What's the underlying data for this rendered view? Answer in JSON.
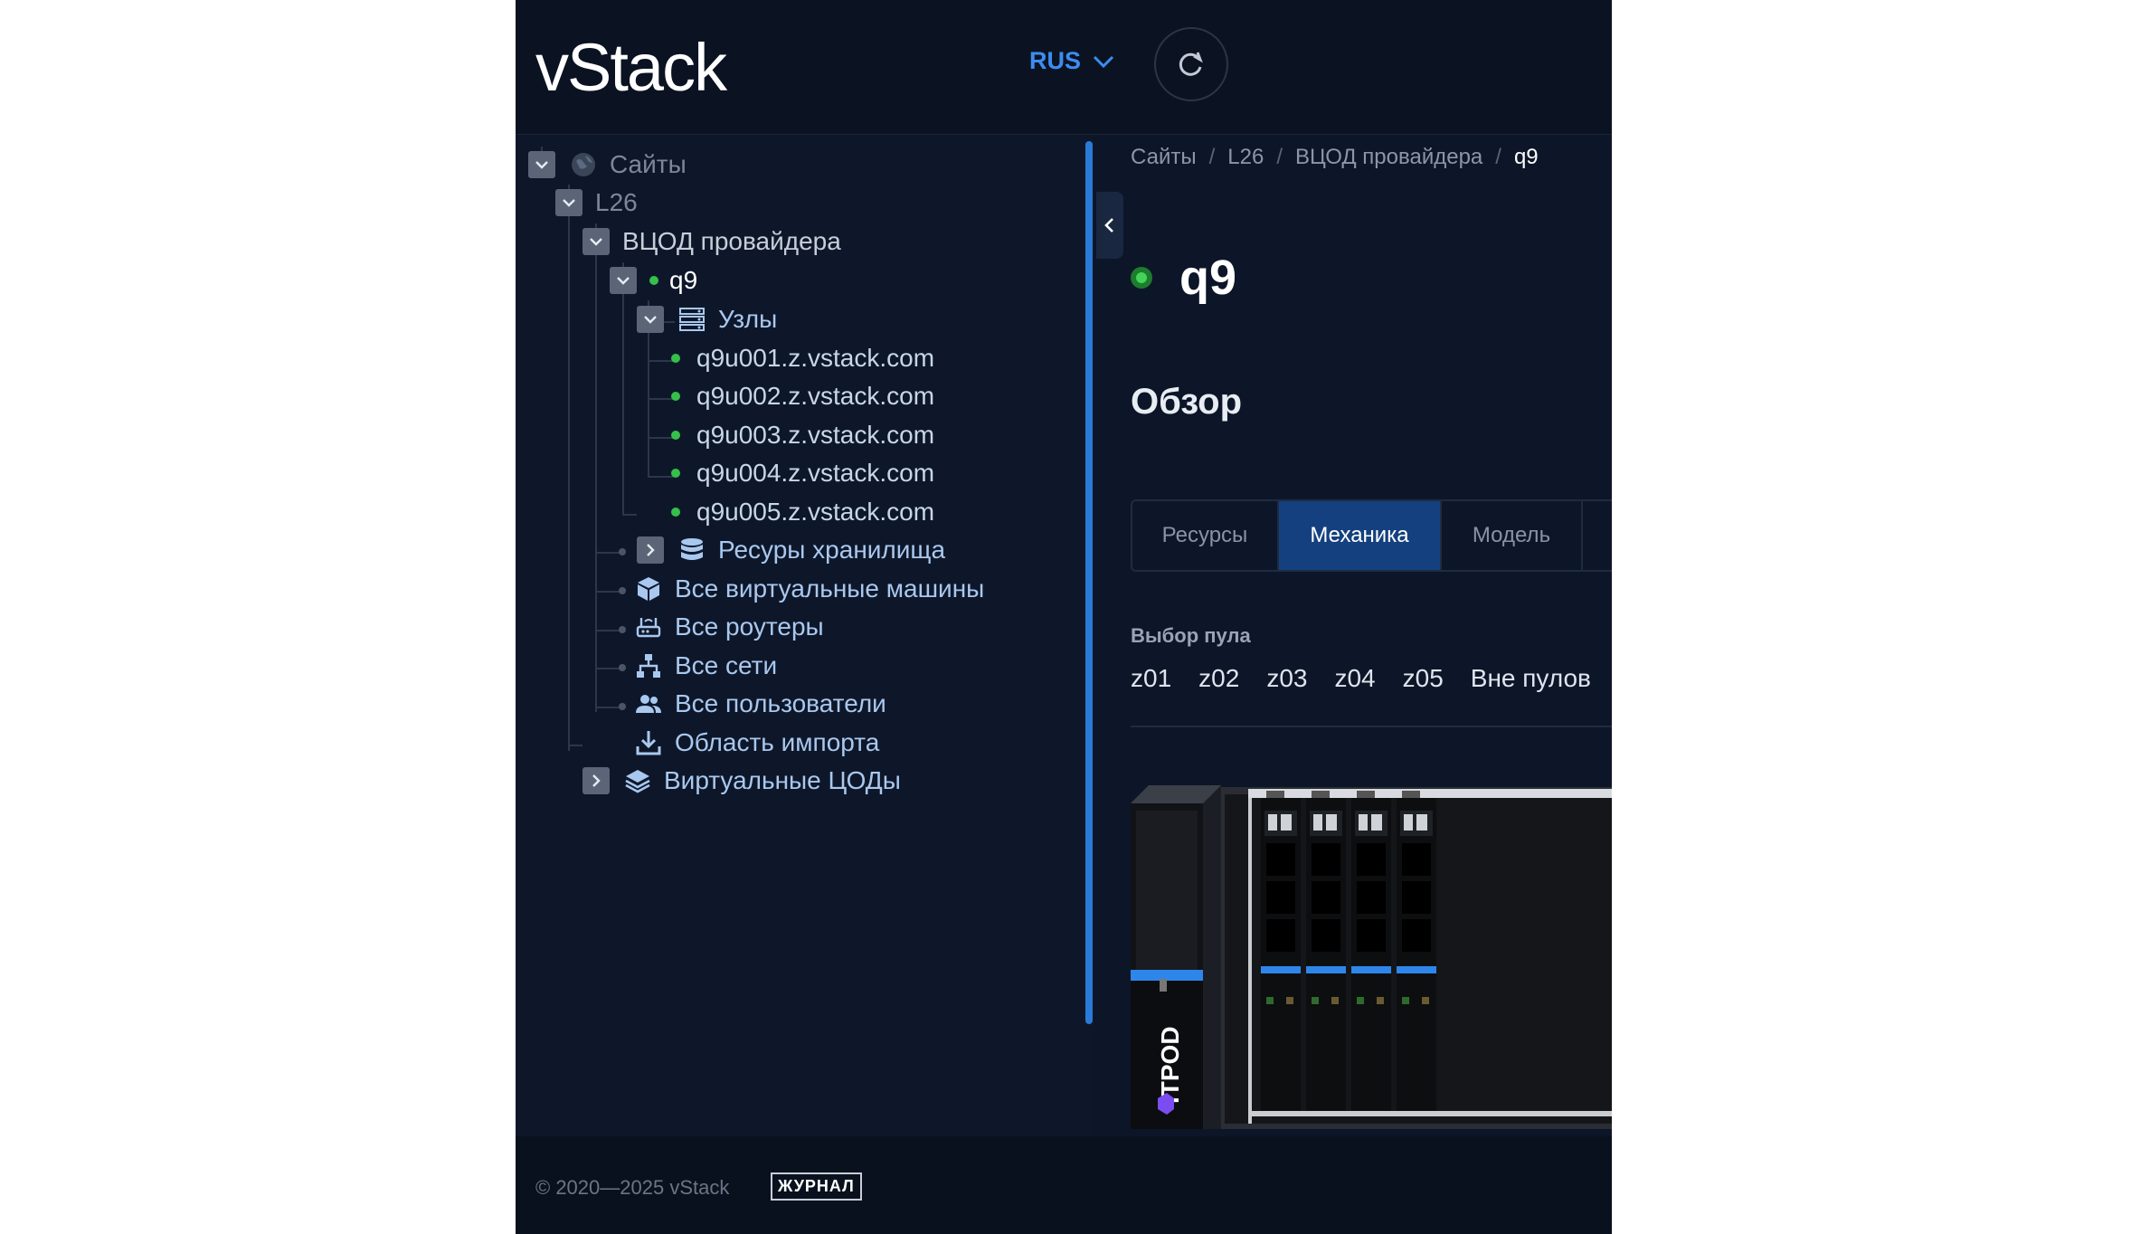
{
  "header": {
    "logo": "vStack",
    "language": "RUS"
  },
  "tree": {
    "root": "Сайты",
    "site": "L26",
    "dc": "ВЦОД провайдера",
    "cluster": "q9",
    "nodes_folder": "Узлы",
    "nodes": [
      "q9u001.z.vstack.com",
      "q9u002.z.vstack.com",
      "q9u003.z.vstack.com",
      "q9u004.z.vstack.com",
      "q9u005.z.vstack.com"
    ],
    "storage": "Ресуры хранилища",
    "items": [
      "Все виртуальные машины",
      "Все роутеры",
      "Все сети",
      "Все пользователи",
      "Область импорта"
    ],
    "virtual_dcs": "Виртуальные ЦОДы"
  },
  "main": {
    "breadcrumb": [
      "Сайты",
      "L26",
      "ВЦОД провайдера",
      "q9"
    ],
    "title": "q9",
    "section": "Обзор",
    "tabs": [
      "Ресурсы",
      "Механика",
      "Модель"
    ],
    "active_tab": "Механика",
    "pool_label": "Выбор пула",
    "pools": [
      "z01",
      "z02",
      "z03",
      "z04",
      "z05",
      "Вне пулов"
    ],
    "chassis_label": "ITPOD"
  },
  "footer": {
    "copyright": "© 2020—2025 vStack",
    "journal": "ЖУРНАЛ"
  },
  "colors": {
    "accent": "#3d8cf0",
    "status_ok": "#35c04a",
    "active_tab": "#14407f",
    "background": "#0d1628"
  }
}
